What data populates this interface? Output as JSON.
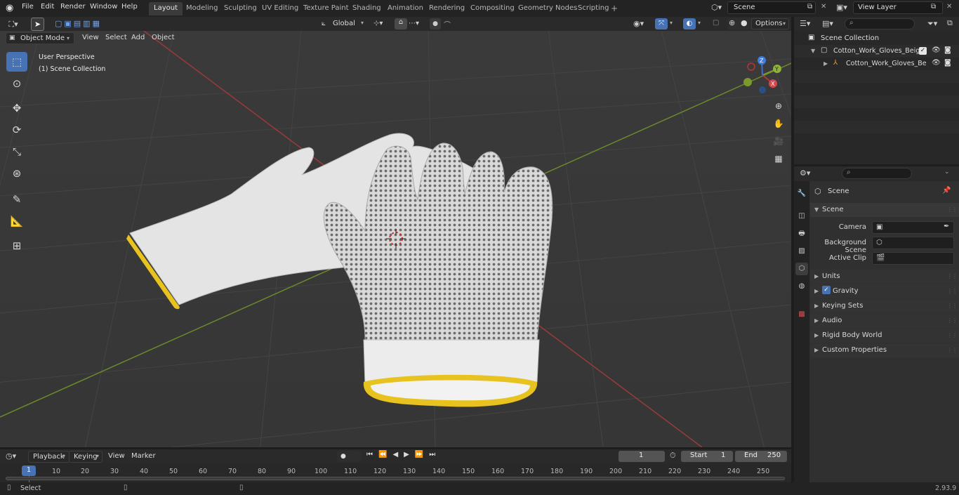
{
  "app": {
    "version": "2.93.9"
  },
  "menu": [
    "File",
    "Edit",
    "Render",
    "Window",
    "Help"
  ],
  "workspaces": {
    "tabs": [
      "Layout",
      "Modeling",
      "Sculpting",
      "UV Editing",
      "Texture Paint",
      "Shading",
      "Animation",
      "Rendering",
      "Compositing",
      "Geometry Nodes",
      "Scripting"
    ],
    "active": "Layout"
  },
  "scene_field": "Scene",
  "view_layer_field": "View Layer",
  "viewport_header": {
    "mode": "Object Mode",
    "menus": [
      "View",
      "Select",
      "Add",
      "Object"
    ],
    "transform_orientation": "Global",
    "options_label": "Options"
  },
  "viewport_overlay": {
    "perspective": "User Perspective",
    "collection": "(1) Scene Collection"
  },
  "gizmo": {
    "x": "X",
    "y": "Y",
    "z": "Z"
  },
  "outliner": {
    "root": "Scene Collection",
    "items": [
      {
        "name": "Cotton_Work_Gloves_Beige",
        "level": 1
      },
      {
        "name": "Cotton_Work_Gloves_Be",
        "level": 2
      }
    ]
  },
  "properties": {
    "context_title": "Scene",
    "section": "Scene",
    "fields": [
      {
        "label": "Camera",
        "value": ""
      },
      {
        "label": "Background Scene",
        "value": ""
      },
      {
        "label": "Active Clip",
        "value": ""
      }
    ],
    "panels": [
      "Units",
      "Gravity",
      "Keying Sets",
      "Audio",
      "Rigid Body World",
      "Custom Properties"
    ],
    "gravity_checked": true
  },
  "timeline": {
    "menus": [
      "Playback",
      "Keying",
      "View",
      "Marker"
    ],
    "current_frame": "1",
    "start_label": "Start",
    "start": "1",
    "end_label": "End",
    "end": "250",
    "ticks": [
      "1",
      "10",
      "20",
      "30",
      "40",
      "50",
      "60",
      "70",
      "80",
      "90",
      "100",
      "110",
      "120",
      "130",
      "140",
      "150",
      "160",
      "170",
      "180",
      "190",
      "200",
      "210",
      "220",
      "230",
      "240",
      "250"
    ]
  },
  "status": {
    "select": "Select"
  },
  "colors": {
    "accent": "#4772b3",
    "axis_x": "#b03a3a",
    "axis_y": "#6a8f2a",
    "glove_cuff": "#e8c21e"
  }
}
